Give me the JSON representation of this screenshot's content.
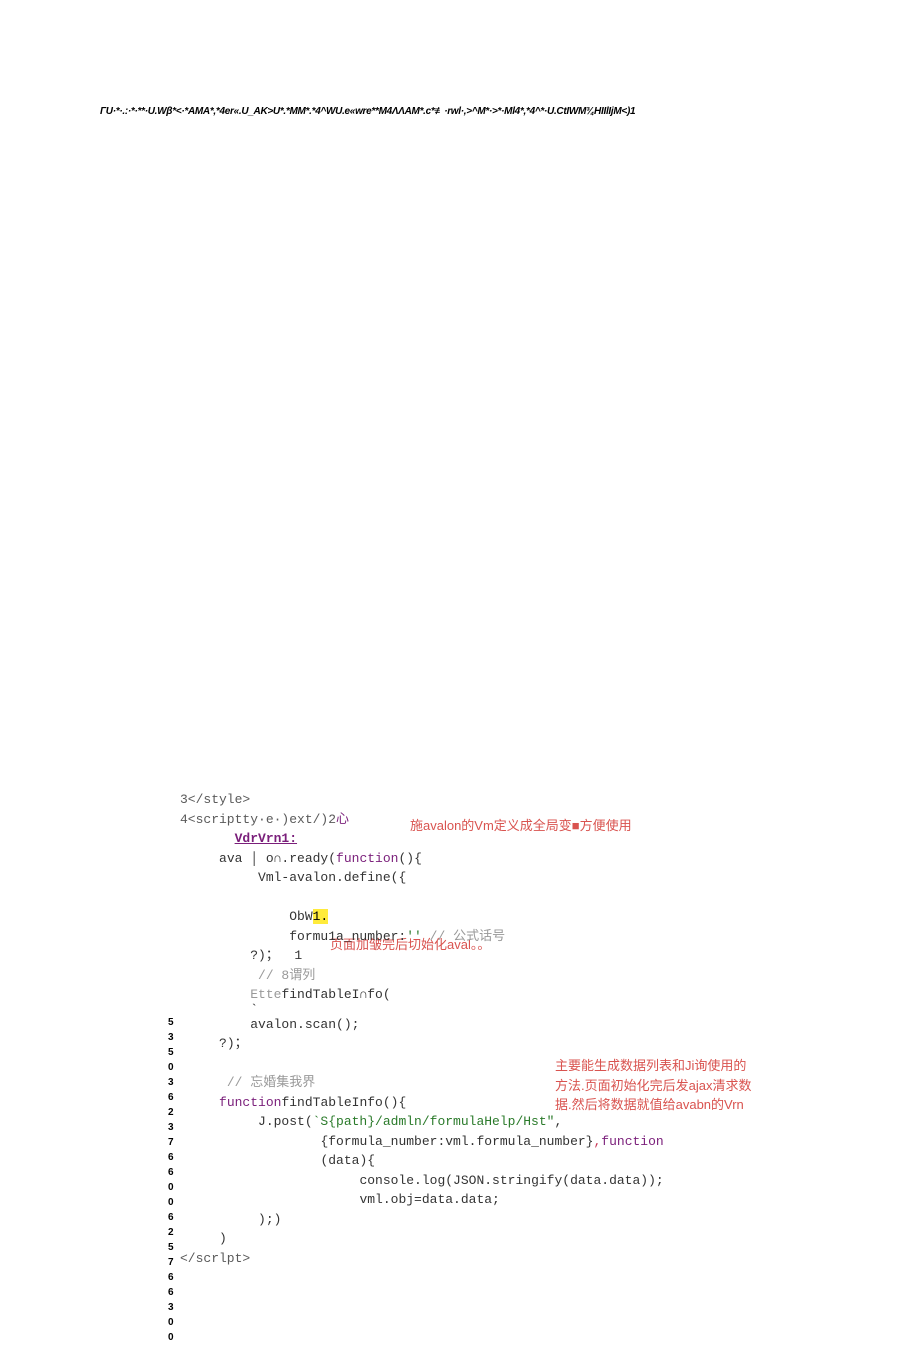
{
  "header": {
    "garbled": "ΓU·*·.:·*·**·U.Wβ*<·*AMA*,*4er«.U_AK>U*.*MM*.*4^WU.e«wre**M4ΛΛAM*.c*≢·rwl·,>^M*·>*·Ml4*,*4^*·U.CtIWM¾HIIlIjM<)1"
  },
  "annotations": {
    "a1": "施avalon的Vm定义成全局变■方便使用",
    "a2": "页面加皱完后切始化aval。。",
    "a3": "主要能生成数据列表和Ji询使用的方法.页面初始化完后发ajax清求数据.然后将数据就值给avabn的Vrn"
  },
  "gutter": [
    "5",
    "3",
    "5",
    "0",
    "3",
    "6",
    "2",
    "3",
    "7",
    "6",
    "6",
    "0",
    "0",
    "6",
    "2",
    "5",
    "7",
    "6",
    "6",
    "3",
    "0",
    "0"
  ],
  "code": {
    "l3": "3</style>",
    "l4a": "4<scriptty·e·)ext/)2",
    "l4b": "心",
    "l5": "VdrVrn1:",
    "l6a": "ava",
    "l6b": "o∩.ready(",
    "l6c": "function",
    "l6d": "(){",
    "l7": "Vml-avalon.define({",
    "l8": "ObW",
    "l8b": "1.",
    "l9a": "formu1a_number:",
    "l9b": "''",
    "l9c": " // 公式话号",
    "l10": "?)；  1",
    "l11": " // 8谓列",
    "l12a": "Ette",
    "l12b": "findTableI∩fo(",
    "l12c": "`",
    "l13": "avalon.scan();",
    "l14": "?)；",
    "l15": " // 忘婚集我界",
    "l16a": "function",
    "l16b": "findTableInfo(){",
    "l17a": "J.post(",
    "l17b": "`S{path}/admln/formulaHelp/Hst\"",
    "l17c": ",",
    "l18a": "{formula_number:vml.formula_number}",
    "l18b": ",",
    "l18c": "function",
    "l19": "(data){",
    "l20": "console.log(JSON.stringify(data.data));",
    "l21": "vml.obj=data.data;",
    "l22": ");)",
    "l23": ")",
    "l24": "</scrlpt>"
  }
}
